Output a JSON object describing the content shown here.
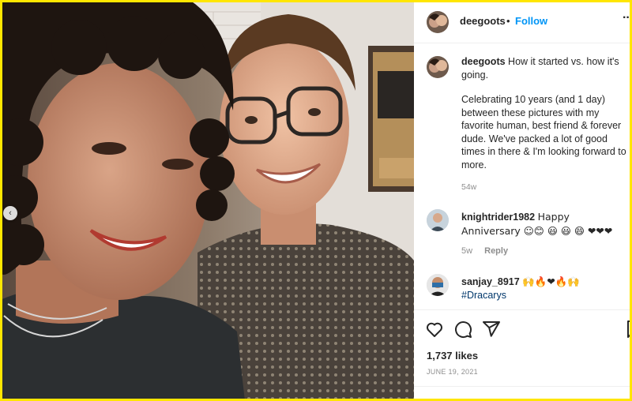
{
  "post": {
    "author": "deegoots",
    "separator": "•",
    "follow_label": "Follow",
    "more_label": "···"
  },
  "caption": {
    "username": "deegoots",
    "line1": "How it started vs. how it's going.",
    "line2": "Celebrating 10 years (and 1 day) between these pictures with my favorite human, best friend & forever dude. We've packed a lot of good times in there & I'm looking forward to more.",
    "time": "54w"
  },
  "comments": [
    {
      "username": "knightrider1982",
      "text": "Happy Anniversary ☺😊 😃 😃 😄 ❤❤❤",
      "time": "5w",
      "reply_label": "Reply"
    },
    {
      "username": "sanjay_8917",
      "text": "🙌🔥❤🔥🙌",
      "hashtag": "#Dracarys"
    }
  ],
  "actions": {
    "like_icon": "heart-icon",
    "comment_icon": "comment-icon",
    "share_icon": "send-icon",
    "save_icon": "bookmark-icon"
  },
  "likes": "1,737 likes",
  "date": "JUNE 19, 2021",
  "carousel": {
    "prev_label": "‹"
  },
  "colors": {
    "link_blue": "#0095f6",
    "hashtag_blue": "#00376b",
    "muted": "#8e8e8e",
    "border": "#efefef",
    "frame": "#ffe600"
  }
}
